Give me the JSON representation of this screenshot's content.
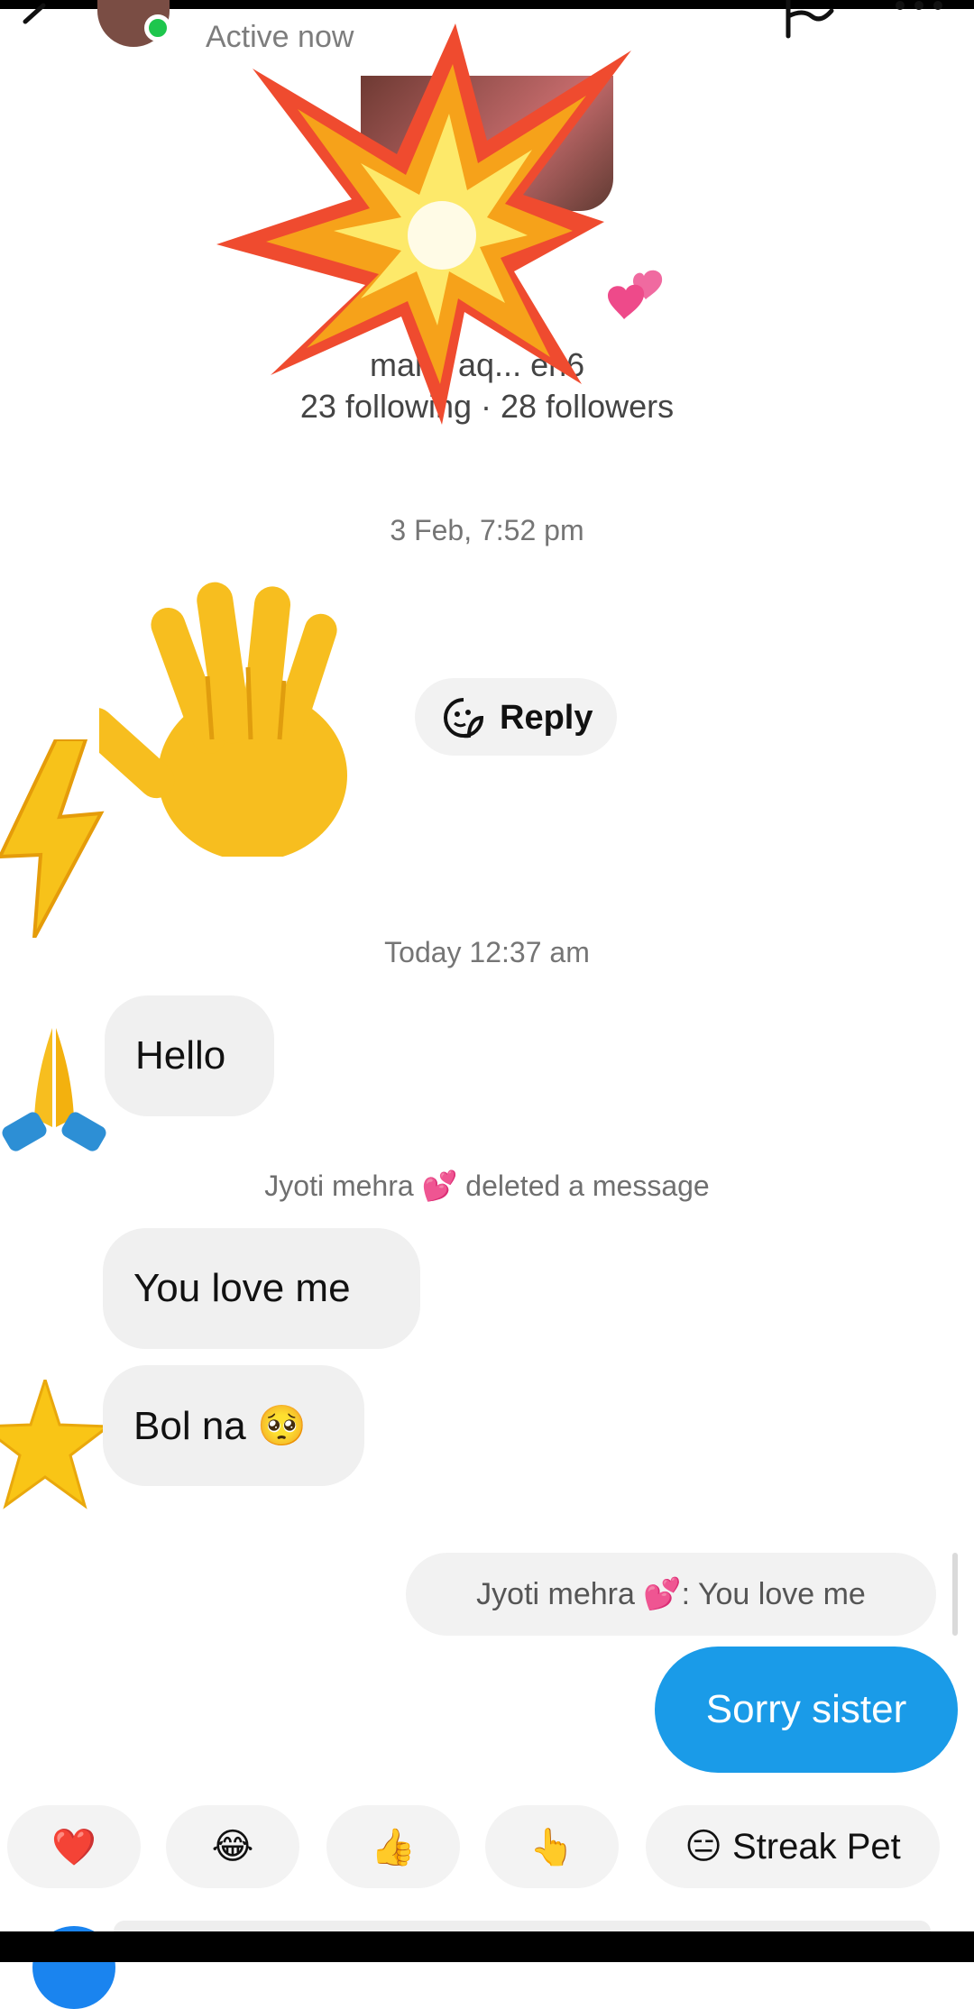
{
  "header": {
    "status": "Active now",
    "icons": [
      "back-icon",
      "flag-icon",
      "more-icon"
    ]
  },
  "profile": {
    "name": "",
    "handle": "mal... aq... en6",
    "stats": "23 following · 28 followers"
  },
  "conversation": {
    "timestamp_1": "3 Feb, 7:52 pm",
    "reply_label": "Reply",
    "timestamp_2": "Today 12:37 am",
    "messages": [
      {
        "text": "Hello"
      },
      {
        "text": "You  love me"
      },
      {
        "text": "Bol na 🥺"
      }
    ],
    "system_notice": "Jyoti mehra 💕 deleted a message",
    "quoted_reply": "Jyoti mehra 💕: You  love me",
    "sent_message": "Sorry sister"
  },
  "quick_reactions": [
    {
      "label": "❤️"
    },
    {
      "label": "😂"
    },
    {
      "label": "👍"
    },
    {
      "label": "👆"
    },
    {
      "label": "😑 Streak Pet"
    }
  ],
  "colors": {
    "accent": "#1a9be8",
    "bubble_bg": "#f0f0f0",
    "online": "#1ec64d"
  }
}
